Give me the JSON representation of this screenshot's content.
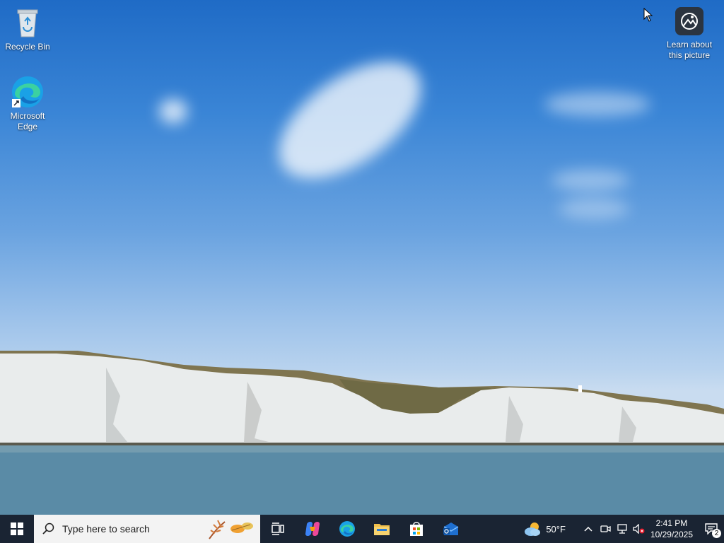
{
  "desktop": {
    "icons": [
      {
        "label": "Recycle Bin",
        "icon": "recycle-bin-icon"
      },
      {
        "label": "Microsoft Edge",
        "icon": "edge-icon"
      }
    ],
    "learn": {
      "label": "Learn about this picture",
      "icon": "camera-icon"
    }
  },
  "taskbar": {
    "search_placeholder": "Type here to search",
    "pinned": [
      {
        "name": "task-view",
        "icon": "task-view-icon"
      },
      {
        "name": "copilot",
        "icon": "copilot-icon"
      },
      {
        "name": "edge",
        "icon": "edge-icon"
      },
      {
        "name": "file-explorer",
        "icon": "folder-icon"
      },
      {
        "name": "microsoft-store",
        "icon": "store-icon"
      },
      {
        "name": "outlook",
        "icon": "outlook-icon"
      }
    ],
    "weather": {
      "temp": "50°F",
      "icon": "cloud-sun-icon"
    },
    "clock": {
      "time": "2:41 PM",
      "date": "10/29/2025"
    },
    "notifications": {
      "count": "2"
    }
  },
  "colors": {
    "taskbar": "#1a2433",
    "sky_top": "#1f6bc6",
    "sea": "#4e7f9c"
  }
}
